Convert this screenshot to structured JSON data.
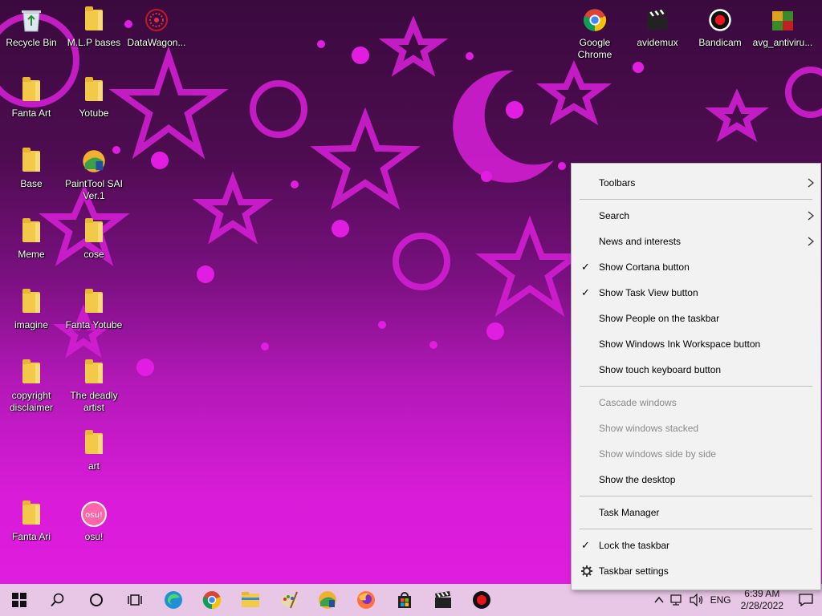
{
  "desktop": {
    "icons": [
      {
        "label": "Recycle Bin",
        "icon": "recycle-bin-icon"
      },
      {
        "label": "M.L.P bases",
        "icon": "folder-icon"
      },
      {
        "label": "DataWagon...",
        "icon": "datawagon-icon"
      },
      {
        "label": "Fanta Art",
        "icon": "folder-icon"
      },
      {
        "label": "Yotube",
        "icon": "folder-icon"
      },
      {
        "label": "Base",
        "icon": "folder-icon"
      },
      {
        "label": "PaintTool SAI Ver.1",
        "icon": "painttool-sai-icon"
      },
      {
        "label": "Meme",
        "icon": "folder-icon"
      },
      {
        "label": "cose",
        "icon": "folder-icon"
      },
      {
        "label": "imagine",
        "icon": "folder-icon"
      },
      {
        "label": "Fanta Yotube",
        "icon": "folder-icon"
      },
      {
        "label": "copyright disclaimer",
        "icon": "folder-icon"
      },
      {
        "label": "The deadly artist",
        "icon": "folder-icon"
      },
      {
        "label": "art",
        "icon": "folder-icon"
      },
      {
        "label": "Fanta Ari",
        "icon": "folder-icon"
      },
      {
        "label": "osu!",
        "icon": "osu-icon"
      },
      {
        "label": "Google Chrome",
        "icon": "chrome-icon"
      },
      {
        "label": "avidemux",
        "icon": "avidemux-icon"
      },
      {
        "label": "Bandicam",
        "icon": "bandicam-icon"
      },
      {
        "label": "avg_antiviru...",
        "icon": "avg-icon"
      }
    ]
  },
  "context_menu": {
    "items": [
      {
        "label": "Toolbars",
        "submenu": true
      },
      {
        "label": "Search",
        "submenu": true
      },
      {
        "label": "News and interests",
        "submenu": true
      },
      {
        "label": "Show Cortana button",
        "checked": true
      },
      {
        "label": "Show Task View button",
        "checked": true
      },
      {
        "label": "Show People on the taskbar"
      },
      {
        "label": "Show Windows Ink Workspace button"
      },
      {
        "label": "Show touch keyboard button"
      },
      {
        "label": "Cascade windows",
        "disabled": true
      },
      {
        "label": "Show windows stacked",
        "disabled": true
      },
      {
        "label": "Show windows side by side",
        "disabled": true
      },
      {
        "label": "Show the desktop"
      },
      {
        "label": "Task Manager"
      },
      {
        "label": "Lock the taskbar",
        "checked": true
      },
      {
        "label": "Taskbar settings",
        "icon": "gear-icon"
      }
    ],
    "check_glyph": "✓",
    "arrow_glyph": "›"
  },
  "taskbar": {
    "buttons": [
      {
        "name": "start-button",
        "icon": "windows-logo-icon"
      },
      {
        "name": "search-button",
        "icon": "search-icon"
      },
      {
        "name": "cortana-button",
        "icon": "cortana-circle-icon"
      },
      {
        "name": "task-view-button",
        "icon": "task-view-icon"
      },
      {
        "name": "edge-button",
        "icon": "edge-icon"
      },
      {
        "name": "chrome-button",
        "icon": "chrome-icon"
      },
      {
        "name": "file-explorer-button",
        "icon": "file-explorer-icon"
      },
      {
        "name": "paint-button",
        "icon": "paint-icon"
      },
      {
        "name": "painttool-sai-button",
        "icon": "painttool-sai-icon"
      },
      {
        "name": "firefox-button",
        "icon": "firefox-icon"
      },
      {
        "name": "store-button",
        "icon": "store-icon"
      },
      {
        "name": "avidemux-button",
        "icon": "avidemux-icon"
      },
      {
        "name": "bandicam-button",
        "icon": "bandicam-icon"
      }
    ],
    "tray": {
      "language": "ENG",
      "time": "6:39 AM",
      "date": "2/28/2022"
    }
  },
  "colors": {
    "taskbar": "#e8c6e6",
    "menu_bg": "#f2f2f2",
    "wallpaper_accent": "#e21de0"
  }
}
